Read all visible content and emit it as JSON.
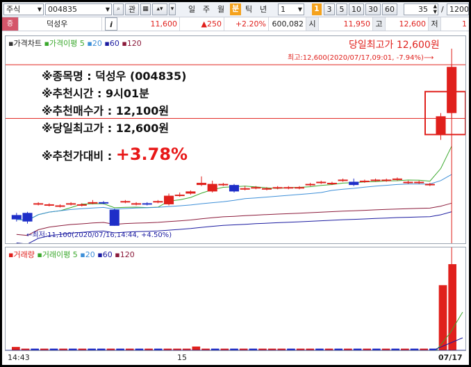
{
  "toolbar": {
    "market": "주식",
    "code": "004835",
    "gwan": "관",
    "periods": [
      "일",
      "주",
      "월",
      "분",
      "틱",
      "년"
    ],
    "active_period": "분",
    "interval": "1",
    "intervals": [
      "3",
      "5",
      "10",
      "30",
      "60"
    ],
    "active_interval_badge": "1",
    "count": "35",
    "slash": "/",
    "max": "1200"
  },
  "inforow": {
    "badge": "증",
    "name": "덕성우",
    "info_btn": "i",
    "price": "11,600",
    "change": "▲250",
    "change_pct": "+2.20%",
    "volume": "600,082",
    "open_label": "시",
    "open": "11,950",
    "high_label": "고",
    "high": "12,600",
    "low_label": "저",
    "low": "1"
  },
  "price_panel": {
    "legend_title": "가격차트",
    "legend_ma": "가격이평",
    "ma_periods": [
      "5",
      "20",
      "60",
      "120"
    ],
    "annotation_title": "당일최고가 12,600원",
    "high_marker": "최고:12,600(2020/07/17,09:01, -7.94%)",
    "low_marker": "최저:11,100(2020/07/16,14:44, +4.50%)"
  },
  "overlay": {
    "line1": "※종목명 : 덕성우 (004835)",
    "line2": "※추천시간 : 9시01분",
    "line3": "※추천매수가 : 12,100원",
    "line4": "※당일최고가 : 12,600원",
    "line5_label": "※추천가대비 :",
    "line5_value": "+3.78%"
  },
  "volume_panel": {
    "legend_title": "거래량",
    "legend_ma": "거래이평",
    "ma_periods": [
      "5",
      "20",
      "60",
      "120"
    ]
  },
  "xaxis": {
    "labels": [
      "14:43",
      "15",
      "07/17"
    ]
  },
  "colors": {
    "up": "#e0201c",
    "down": "#1e2ec8",
    "ma5": "#3aa82c",
    "ma20": "#3d8fd8",
    "ma60": "#1a1aa0",
    "ma120": "#8b1a3a",
    "accent": "#f5a21c"
  },
  "chart_data": {
    "type": "candlestick",
    "price_candles": [
      {
        "o": 11200,
        "c": 11160,
        "h": 11220,
        "l": 11140
      },
      {
        "o": 11220,
        "c": 11140,
        "h": 11230,
        "l": 11120
      },
      {
        "o": 11300,
        "c": 11310,
        "h": 11320,
        "l": 11290
      },
      {
        "o": 11290,
        "c": 11300,
        "h": 11310,
        "l": 11280
      },
      {
        "o": 11280,
        "c": 11290,
        "h": 11300,
        "l": 11270
      },
      {
        "o": 11300,
        "c": 11310,
        "h": 11320,
        "l": 11290
      },
      {
        "o": 11290,
        "c": 11300,
        "h": 11310,
        "l": 11280
      },
      {
        "o": 11310,
        "c": 11320,
        "h": 11340,
        "l": 11300
      },
      {
        "o": 11320,
        "c": 11310,
        "h": 11330,
        "l": 11300
      },
      {
        "o": 11250,
        "c": 11100,
        "h": 11260,
        "l": 11100
      },
      {
        "o": 11320,
        "c": 11330,
        "h": 11340,
        "l": 11310
      },
      {
        "o": 11300,
        "c": 11310,
        "h": 11320,
        "l": 11290
      },
      {
        "o": 11310,
        "c": 11300,
        "h": 11320,
        "l": 11290
      },
      {
        "o": 11320,
        "c": 11330,
        "h": 11340,
        "l": 11310
      },
      {
        "o": 11300,
        "c": 11380,
        "h": 11400,
        "l": 11290
      },
      {
        "o": 11380,
        "c": 11390,
        "h": 11410,
        "l": 11370
      },
      {
        "o": 11400,
        "c": 11420,
        "h": 11430,
        "l": 11390
      },
      {
        "o": 11480,
        "c": 11500,
        "h": 11560,
        "l": 11470
      },
      {
        "o": 11420,
        "c": 11490,
        "h": 11520,
        "l": 11410
      },
      {
        "o": 11480,
        "c": 11490,
        "h": 11500,
        "l": 11470
      },
      {
        "o": 11480,
        "c": 11420,
        "h": 11490,
        "l": 11410
      },
      {
        "o": 11440,
        "c": 11450,
        "h": 11470,
        "l": 11430
      },
      {
        "o": 11450,
        "c": 11460,
        "h": 11470,
        "l": 11440
      },
      {
        "o": 11440,
        "c": 11450,
        "h": 11460,
        "l": 11430
      },
      {
        "o": 11450,
        "c": 11460,
        "h": 11470,
        "l": 11440
      },
      {
        "o": 11450,
        "c": 11460,
        "h": 11470,
        "l": 11440
      },
      {
        "o": 11450,
        "c": 11460,
        "h": 11470,
        "l": 11440
      },
      {
        "o": 11480,
        "c": 11490,
        "h": 11500,
        "l": 11470
      },
      {
        "o": 11500,
        "c": 11510,
        "h": 11520,
        "l": 11490
      },
      {
        "o": 11490,
        "c": 11500,
        "h": 11510,
        "l": 11480
      },
      {
        "o": 11520,
        "c": 11530,
        "h": 11540,
        "l": 11510
      },
      {
        "o": 11510,
        "c": 11480,
        "h": 11540,
        "l": 11470
      },
      {
        "o": 11510,
        "c": 11520,
        "h": 11530,
        "l": 11500
      },
      {
        "o": 11520,
        "c": 11530,
        "h": 11540,
        "l": 11510
      },
      {
        "o": 11520,
        "c": 11530,
        "h": 11540,
        "l": 11510
      },
      {
        "o": 11530,
        "c": 11540,
        "h": 11550,
        "l": 11520
      },
      {
        "o": 11500,
        "c": 11510,
        "h": 11520,
        "l": 11490
      },
      {
        "o": 11500,
        "c": 11510,
        "h": 11520,
        "l": 11490
      },
      {
        "o": 11480,
        "c": 11490,
        "h": 11500,
        "l": 11470
      },
      {
        "o": 11950,
        "c": 12120,
        "h": 12150,
        "l": 11900
      },
      {
        "o": 12150,
        "c": 12580,
        "h": 12600,
        "l": 12100
      }
    ],
    "volume_bars": [
      80,
      40,
      40,
      40,
      40,
      40,
      40,
      40,
      40,
      40,
      40,
      40,
      40,
      40,
      40,
      40,
      40,
      40,
      40,
      90,
      40,
      40,
      40,
      40,
      40,
      40,
      40,
      40,
      40,
      40,
      40,
      40,
      40,
      40,
      40,
      40,
      40,
      40,
      40,
      40,
      40,
      40,
      40,
      40,
      40,
      1550,
      2050
    ],
    "volume_colors": [
      "up",
      "up",
      "down",
      "up",
      "down",
      "up",
      "down",
      "up",
      "down",
      "down",
      "up",
      "down",
      "up",
      "down",
      "up",
      "down",
      "up",
      "up",
      "up",
      "up",
      "up",
      "down",
      "up",
      "down",
      "up",
      "down",
      "up",
      "up",
      "up",
      "down",
      "up",
      "up",
      "down",
      "up",
      "down",
      "up",
      "down",
      "up",
      "down",
      "up",
      "down",
      "up",
      "down",
      "up",
      "down",
      "up",
      "up"
    ],
    "ylim": [
      10950,
      12750
    ]
  }
}
